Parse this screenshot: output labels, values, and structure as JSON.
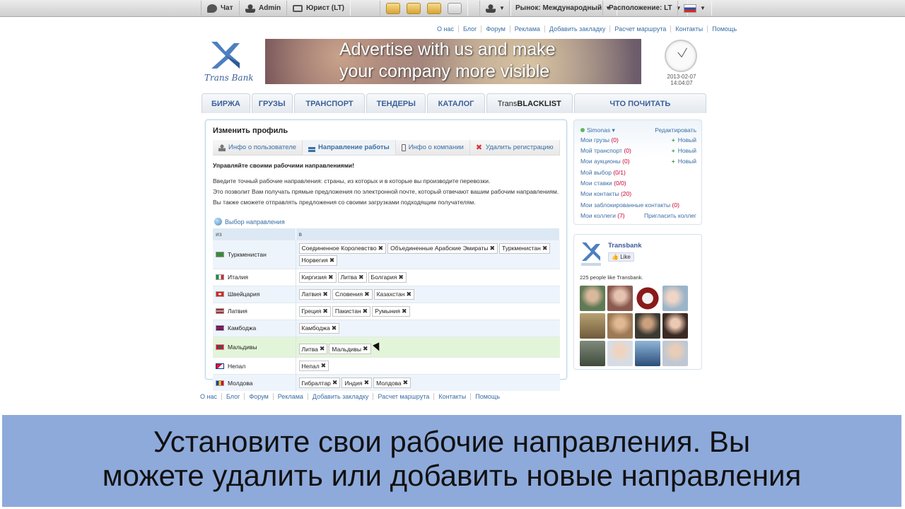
{
  "topbar": {
    "chat": "Чат",
    "user": "Admin",
    "role": "Юрист (LT)",
    "market": "Рынок: Международный",
    "location": "Расположение: LT"
  },
  "toplinks": [
    "О нас",
    "Блог",
    "Форум",
    "Реклама",
    "Добавить закладку",
    "Расчет маршрута",
    "Контакты",
    "Помощь"
  ],
  "logo": {
    "text": "Trans Bank"
  },
  "banner": {
    "line1": "Advertise with us and make",
    "line2": "your company more visible"
  },
  "clock": {
    "date": "2013-02-07",
    "time": "14:04:07"
  },
  "mainnav": [
    "БИРЖА",
    "ГРУЗЫ",
    "ТРАНСПОРТ",
    "ТЕНДЕРЫ",
    "КАТАЛОГ",
    "TransBLACKLIST",
    "ЧТО ПОЧИТАТЬ"
  ],
  "blacklist": {
    "prefix": "Trans",
    "bold": "BLACKLIST"
  },
  "profile": {
    "title": "Изменить профиль",
    "tabs": [
      "Инфо о пользователе",
      "Направление работы",
      "Инфо о компании",
      "Удалить регистрацию"
    ],
    "heading": "Управляйте своими рабочими направлениями!",
    "text1": "Введите точный рабочие направления: страны, из которых и в которые вы производите перевозки.",
    "text2": "Это позволит Вам получать прямые предложения по электронной почте, который отвечают вашим рабочим направлениям. Вы также сможете отправлять предложения со своими загрузками подходящим получателям.",
    "dir_link": "Выбор направления",
    "col_from": "из",
    "col_to": "в",
    "rows": [
      {
        "from": "Туркменистан",
        "to": [
          "Соединенное Королевство",
          "Объединенные Арабские Эмираты",
          "Туркменистан",
          "Норвегия"
        ]
      },
      {
        "from": "Италия",
        "to": [
          "Киргизия",
          "Литва",
          "Болгария"
        ]
      },
      {
        "from": "Швейцария",
        "to": [
          "Латвия",
          "Словения",
          "Казахстан"
        ]
      },
      {
        "from": "Латвия",
        "to": [
          "Греция",
          "Пакистан",
          "Румыния"
        ]
      },
      {
        "from": "Камбоджа",
        "to": [
          "Камбоджа"
        ]
      },
      {
        "from": "Мальдивы",
        "to": [
          "Литва",
          "Мальдивы"
        ]
      },
      {
        "from": "Непал",
        "to": [
          "Непал"
        ]
      },
      {
        "from": "Молдова",
        "to": [
          "Гибралтар",
          "Индия",
          "Молдова"
        ]
      }
    ]
  },
  "sidebar": {
    "user": "Simonas",
    "edit": "Редактировать",
    "new": "Новый",
    "items": [
      {
        "label": "Мои грузы",
        "count": "(0)"
      },
      {
        "label": "Мой транспорт",
        "count": "(0)"
      },
      {
        "label": "Мои аукционы",
        "count": "(0)"
      },
      {
        "label": "Мой выбор",
        "count": "(0/1)"
      },
      {
        "label": "Мои ставки",
        "count": "(0/0)"
      },
      {
        "label": "Мои контакты",
        "count": "(20)"
      },
      {
        "label": "Мои заблокированные контакты",
        "count": "(0)"
      },
      {
        "label": "Мои коллеги",
        "count": "(7)"
      }
    ],
    "invite": "Пригласить коллег"
  },
  "facebook": {
    "name": "Transbank",
    "like": "Like",
    "count": "225 people like Transbank."
  },
  "footer_links": [
    "О нас",
    "Блог",
    "Форум",
    "Реклама",
    "Добавить закладку",
    "Расчет маршрута",
    "Контакты",
    "Помощь"
  ],
  "caption": {
    "line1": "Установите свои рабочие направления. Вы",
    "line2": "можете удалить или добавить новые направления"
  },
  "colors": {
    "link": "#3a6ea5",
    "caption_bg": "#8eaadb",
    "accent": "#3b5f9a"
  }
}
